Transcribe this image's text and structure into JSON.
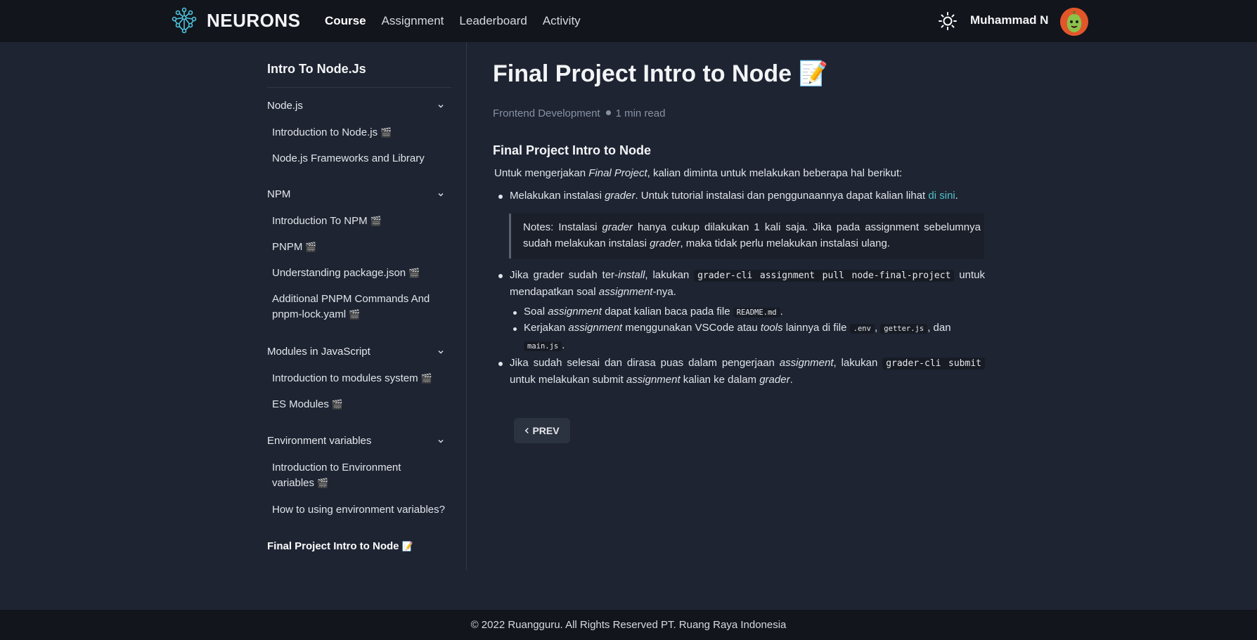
{
  "header": {
    "brand": "NEURONS",
    "nav": [
      "Course",
      "Assignment",
      "Leaderboard",
      "Activity"
    ],
    "active_nav": "Course",
    "username": "Muhammad N",
    "theme_icon": "sun-icon"
  },
  "sidebar": {
    "course_title": "Intro To Node.Js",
    "sections": [
      {
        "label": "Node.js",
        "items": [
          {
            "label": "Introduction to Node.js",
            "emoji": "🎬"
          },
          {
            "label": "Node.js Frameworks and Library",
            "emoji": ""
          }
        ]
      },
      {
        "label": "NPM",
        "items": [
          {
            "label": "Introduction To NPM",
            "emoji": "🎬"
          },
          {
            "label": "PNPM",
            "emoji": "🎬"
          },
          {
            "label": "Understanding package.json",
            "emoji": "🎬"
          },
          {
            "label": "Additional PNPM Commands And",
            "label2": "pnpm-lock.yaml",
            "emoji": "🎬"
          }
        ]
      },
      {
        "label": "Modules in JavaScript",
        "items": [
          {
            "label": "Introduction to modules system",
            "emoji": "🎬"
          },
          {
            "label": "ES Modules",
            "emoji": "🎬"
          }
        ]
      },
      {
        "label": "Environment variables",
        "items": [
          {
            "label": "Introduction to Environment",
            "label2": "variables",
            "emoji": "🎬"
          },
          {
            "label": "How to using environment variables?",
            "emoji": ""
          }
        ]
      }
    ],
    "current_item": {
      "label": "Final Project Intro to Node",
      "emoji": "📝"
    }
  },
  "main": {
    "title": "Final Project Intro to Node 📝",
    "category": "Frontend Development",
    "read_time": "1 min read",
    "heading": "Final Project Intro to Node",
    "intro": {
      "pre": "Untuk mengerjakan ",
      "em": "Final Project",
      "post": ", kalian diminta untuk melakukan beberapa hal berikut:"
    },
    "bullet1": {
      "pre": "Melakukan instalasi ",
      "em": "grader",
      "mid": ". Untuk tutorial instalasi dan penggunaannya dapat kalian lihat ",
      "link": "di sini",
      "post": "."
    },
    "note": {
      "pre": "Notes: Instalasi ",
      "em1": "grader",
      "mid": " hanya cukup dilakukan 1 kali saja. Jika pada assignment sebelumnya sudah melakukan instalasi ",
      "em2": "grader",
      "post": ", maka tidak perlu melakukan instalasi ulang."
    },
    "bullet2": {
      "pre": "Jika grader sudah ter-",
      "em1": "install",
      "mid": ", lakukan ",
      "code": "grader-cli assignment pull node-final-project",
      "mid2": " untuk mendapatkan soal ",
      "em2": "assignment",
      "post": "-nya."
    },
    "sub1": {
      "pre": "Soal ",
      "em": "assignment",
      "mid": " dapat kalian baca pada file ",
      "code": "README.md",
      "post": "."
    },
    "sub2": {
      "pre": "Kerjakan ",
      "em1": "assignment",
      "mid": " menggunakan VSCode atau ",
      "em2": "tools",
      "mid2": " lainnya di file ",
      "code1": ".env",
      "sep1": ", ",
      "code2": "getter.js",
      "sep2": ", dan ",
      "code3": "main.js",
      "post": "."
    },
    "bullet3": {
      "pre": "Jika sudah selesai dan dirasa puas dalam pengerjaan ",
      "em1": "assignment",
      "mid": ", lakukan ",
      "code": "grader-cli submit",
      "mid2": " untuk melakukan submit ",
      "em2": "assignment",
      "mid3": " kalian ke dalam ",
      "em3": "grader",
      "post": "."
    },
    "prev_label": "PREV"
  },
  "footer": {
    "text": "© 2022 Ruangguru. All Rights Reserved PT. Ruang Raya Indonesia"
  }
}
